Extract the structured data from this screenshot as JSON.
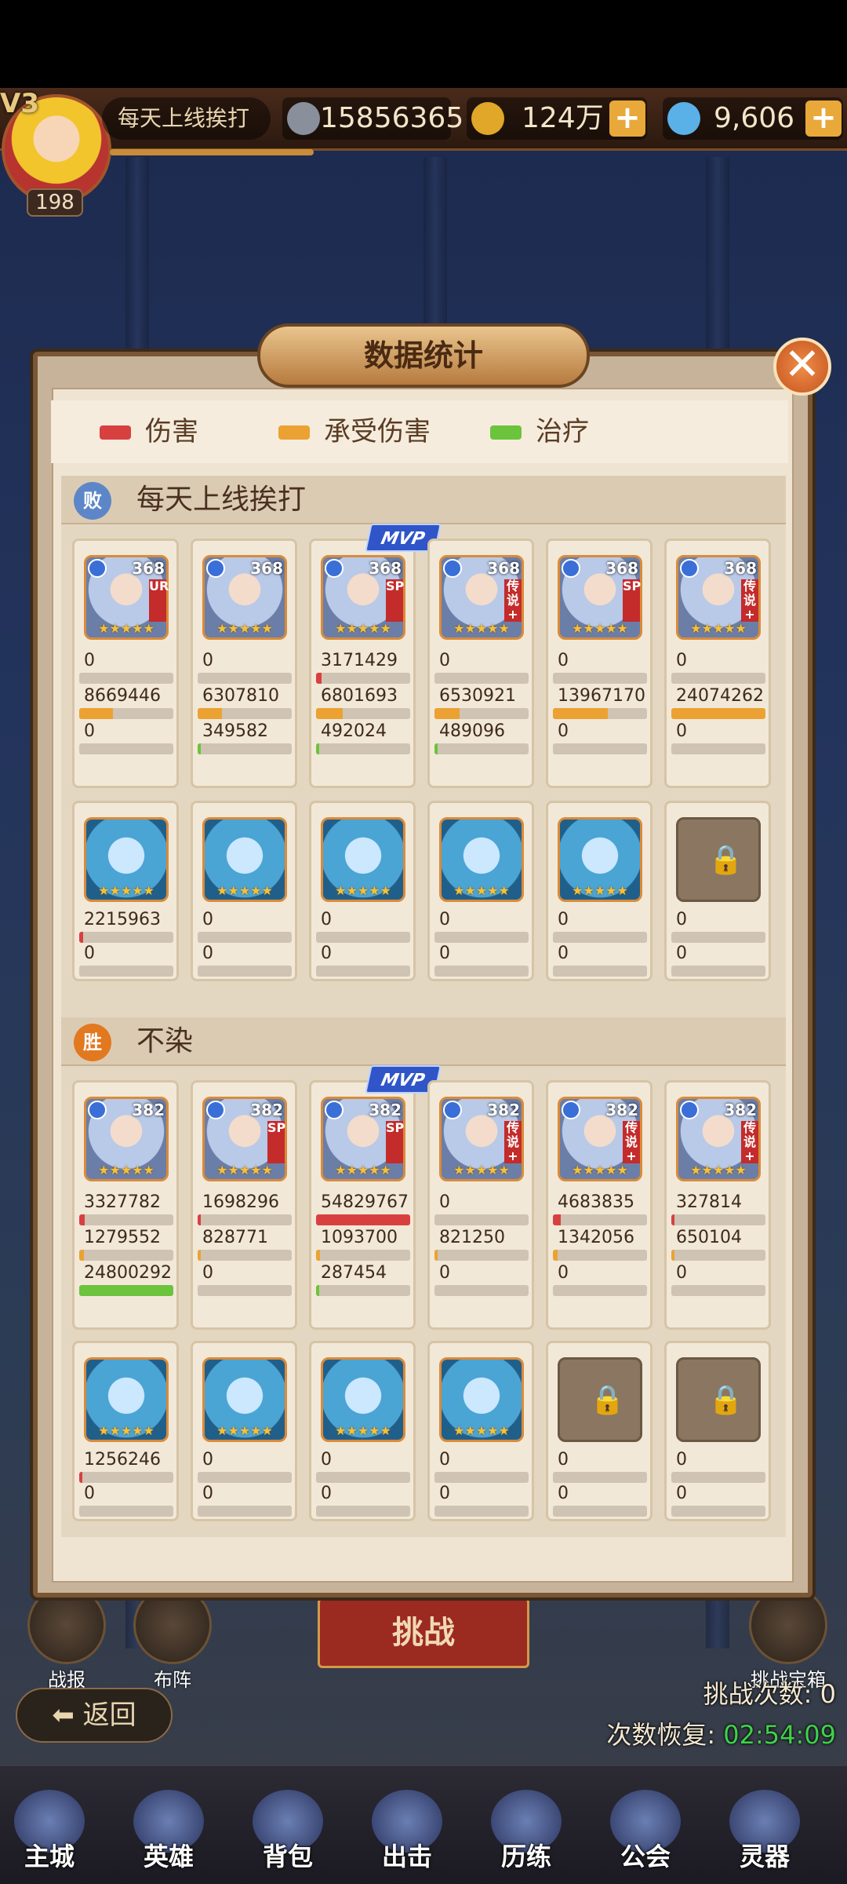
{
  "player": {
    "vip": "V3",
    "level": "198",
    "name": "每天上线挨打"
  },
  "resources": {
    "power": "15856365",
    "gold": "124万",
    "diamonds": "9,606",
    "plus": "+"
  },
  "modal": {
    "title": "数据统计",
    "legend": [
      {
        "label": "伤害",
        "color": "#d84040"
      },
      {
        "label": "承受伤害",
        "color": "#eba233"
      },
      {
        "label": "治疗",
        "color": "#6cc33c"
      }
    ],
    "teams": [
      {
        "name": "每天上线挨打",
        "result": "败",
        "heroes": [
          {
            "level": "368",
            "tier": "UR",
            "mvp": false,
            "damage": "0",
            "taken": "8669446",
            "heal": "0",
            "dmg_frac": 0,
            "taken_frac": 0.36,
            "heal_frac": 0
          },
          {
            "level": "368",
            "tier": "",
            "mvp": false,
            "damage": "0",
            "taken": "6307810",
            "heal": "349582",
            "dmg_frac": 0,
            "taken_frac": 0.26,
            "heal_frac": 0.014
          },
          {
            "level": "368",
            "tier": "SP",
            "mvp": true,
            "damage": "3171429",
            "taken": "6801693",
            "heal": "492024",
            "dmg_frac": 0.058,
            "taken_frac": 0.28,
            "heal_frac": 0.02
          },
          {
            "level": "368",
            "tier": "传说+",
            "mvp": false,
            "damage": "0",
            "taken": "6530921",
            "heal": "489096",
            "dmg_frac": 0,
            "taken_frac": 0.27,
            "heal_frac": 0.02
          },
          {
            "level": "368",
            "tier": "SP",
            "mvp": false,
            "damage": "0",
            "taken": "13967170",
            "heal": "0",
            "dmg_frac": 0,
            "taken_frac": 0.58,
            "heal_frac": 0
          },
          {
            "level": "368",
            "tier": "传说+",
            "mvp": false,
            "damage": "0",
            "taken": "24074262",
            "heal": "0",
            "dmg_frac": 0,
            "taken_frac": 1.0,
            "heal_frac": 0
          }
        ],
        "pets": [
          {
            "locked": false,
            "damage": "2215963",
            "heal": "0",
            "dmg_frac": 0.04
          },
          {
            "locked": false,
            "damage": "0",
            "heal": "0",
            "dmg_frac": 0
          },
          {
            "locked": false,
            "damage": "0",
            "heal": "0",
            "dmg_frac": 0
          },
          {
            "locked": false,
            "damage": "0",
            "heal": "0",
            "dmg_frac": 0
          },
          {
            "locked": false,
            "damage": "0",
            "heal": "0",
            "dmg_frac": 0
          },
          {
            "locked": true,
            "damage": "0",
            "heal": "0",
            "dmg_frac": 0
          }
        ]
      },
      {
        "name": "不染",
        "result": "胜",
        "heroes": [
          {
            "level": "382",
            "tier": "",
            "mvp": false,
            "damage": "3327782",
            "taken": "1279552",
            "heal": "24800292",
            "dmg_frac": 0.061,
            "taken_frac": 0.05,
            "heal_frac": 1.0
          },
          {
            "level": "382",
            "tier": "SP",
            "mvp": false,
            "damage": "1698296",
            "taken": "828771",
            "heal": "0",
            "dmg_frac": 0.031,
            "taken_frac": 0.033,
            "heal_frac": 0
          },
          {
            "level": "382",
            "tier": "SP",
            "mvp": true,
            "damage": "54829767",
            "taken": "1093700",
            "heal": "287454",
            "dmg_frac": 1.0,
            "taken_frac": 0.044,
            "heal_frac": 0.012
          },
          {
            "level": "382",
            "tier": "传说+",
            "mvp": false,
            "damage": "0",
            "taken": "821250",
            "heal": "0",
            "dmg_frac": 0,
            "taken_frac": 0.033,
            "heal_frac": 0
          },
          {
            "level": "382",
            "tier": "传说+",
            "mvp": false,
            "damage": "4683835",
            "taken": "1342056",
            "heal": "0",
            "dmg_frac": 0.085,
            "taken_frac": 0.054,
            "heal_frac": 0
          },
          {
            "level": "382",
            "tier": "传说+",
            "mvp": false,
            "damage": "327814",
            "taken": "650104",
            "heal": "0",
            "dmg_frac": 0.006,
            "taken_frac": 0.026,
            "heal_frac": 0
          }
        ],
        "pets": [
          {
            "locked": false,
            "damage": "1256246",
            "heal": "0",
            "dmg_frac": 0.023
          },
          {
            "locked": false,
            "damage": "0",
            "heal": "0",
            "dmg_frac": 0
          },
          {
            "locked": false,
            "damage": "0",
            "heal": "0",
            "dmg_frac": 0
          },
          {
            "locked": false,
            "damage": "0",
            "heal": "0",
            "dmg_frac": 0
          },
          {
            "locked": true,
            "damage": "0",
            "heal": "0",
            "dmg_frac": 0
          },
          {
            "locked": true,
            "damage": "0",
            "heal": "0",
            "dmg_frac": 0
          }
        ]
      }
    ]
  },
  "bottom": {
    "challenge": "挑战",
    "report": "战报",
    "formation": "布阵",
    "chest": "挑战宝箱",
    "count": "挑战次数: 0",
    "recover_label": "次数恢复: ",
    "recover_time": "02:54:09",
    "back": "返回",
    "nav": [
      "主城",
      "英雄",
      "背包",
      "出击",
      "历练",
      "公会",
      "灵器"
    ]
  }
}
